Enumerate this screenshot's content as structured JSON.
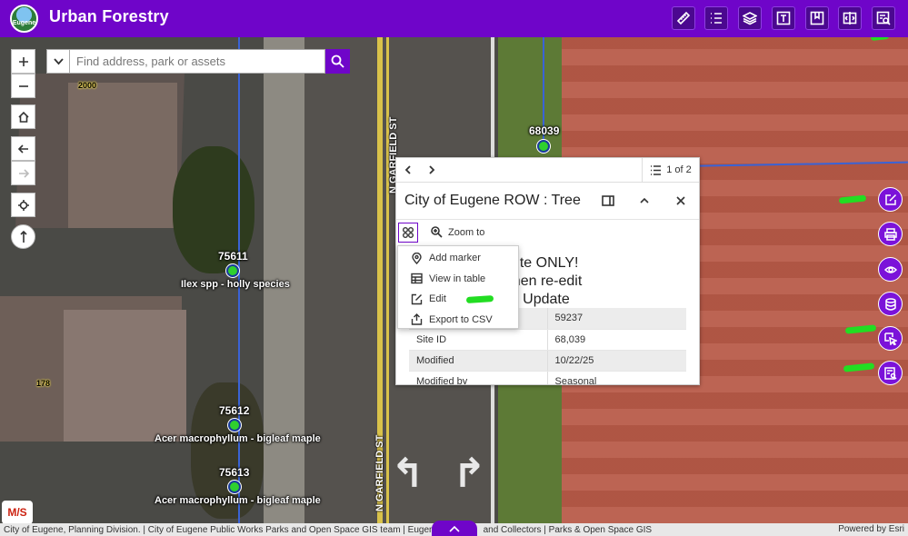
{
  "header": {
    "logo_text": "Eugene",
    "title": "Urban Forestry",
    "tools": [
      "measure-icon",
      "legend-icon",
      "layers-icon",
      "text-icon",
      "bookmark-icon",
      "swipe-icon",
      "query-icon"
    ]
  },
  "search": {
    "placeholder": "Find address, park or assets"
  },
  "map": {
    "streets": [
      "N GARFIELD ST",
      "N GARFIELD ST"
    ],
    "addresses": [
      "2000",
      "178"
    ],
    "trees": [
      {
        "id": "68039",
        "name": ""
      },
      {
        "id": "75611",
        "name": "Ilex spp - holly species"
      },
      {
        "id": "75612",
        "name": "Acer macrophyllum - bigleaf maple"
      },
      {
        "id": "75613",
        "name": "Acer macrophyllum - bigleaf maple"
      }
    ]
  },
  "popup": {
    "pager": "1 of 2",
    "title": "City of Eugene ROW : Tree",
    "zoom_to": "Zoom to",
    "notice": "adding a new Site ONLY! w site, submit then re-edit r \"Site ID\". Click Update",
    "notice_lines": [
      "adding a new Site ONLY!",
      "w site, submit then re-edit",
      "r \"Site ID\". Click Update"
    ],
    "rows": [
      {
        "key": "",
        "value": "59237"
      },
      {
        "key": "Site ID",
        "value": "68,039"
      },
      {
        "key": "Modified",
        "value": "10/22/25"
      },
      {
        "key": "Modified by",
        "value": "Seasonal"
      }
    ]
  },
  "menu": {
    "items": [
      {
        "label": "Add marker",
        "icon": "pin-icon"
      },
      {
        "label": "View in table",
        "icon": "table-icon"
      },
      {
        "label": "Edit",
        "icon": "edit-icon"
      },
      {
        "label": "Export to CSV",
        "icon": "export-icon"
      }
    ]
  },
  "footer": {
    "attribution": "City of Eugene, Planning Division. | City of Eugene Public Works Parks and Open Space GIS team | Eugen",
    "attribution_tail": "and Collectors | Parks & Open Space GIS",
    "powered": "Powered by Esri"
  },
  "badge": "M/S",
  "colors": {
    "brand": "#6f05c9",
    "tree_point": "#2fd02f",
    "parcel_line": "#3a63d6"
  }
}
